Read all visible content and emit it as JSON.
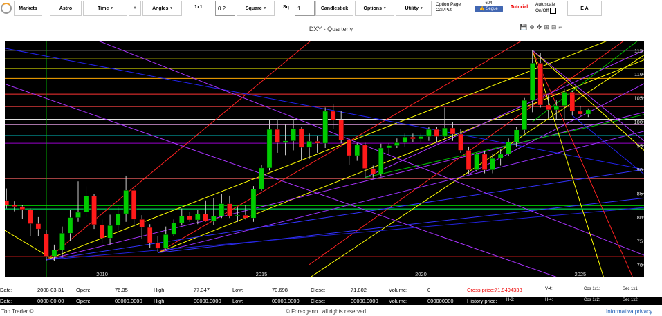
{
  "toolbar": {
    "markets": "Markets",
    "astro": "Astro",
    "time": "Time",
    "angles": "Angles",
    "ratio_label": "1x1",
    "ratio_value": "0.2",
    "square": "Square",
    "sq_label": "Sq",
    "sq_value": "1",
    "candlestick": "Candlestick",
    "options": "Options",
    "utility": "Utility",
    "option_page_line1": "Option Page",
    "option_page_line2": "Call/Put",
    "segue_count": "604",
    "segue_label": "Segue",
    "tutorial": "Tutorial",
    "autoscale_line1": "Autoscale",
    "autoscale_line2": "On/Off",
    "ea": "E A"
  },
  "title": "DXY - Quarterly",
  "chart_data": {
    "type": "candlestick",
    "title": "DXY - Quarterly",
    "x_ticks": [
      "2010",
      "2015",
      "2020",
      "2025"
    ],
    "y_ticks": [
      70,
      75,
      80,
      85,
      90,
      95,
      100,
      105,
      110,
      115
    ],
    "ylim": [
      67.5,
      117
    ],
    "candles": [
      {
        "x": 2007.0,
        "o": 83.5,
        "h": 86.0,
        "l": 81.8,
        "c": 82.5
      },
      {
        "x": 2007.25,
        "o": 82.5,
        "h": 83.3,
        "l": 81.2,
        "c": 82.2
      },
      {
        "x": 2007.5,
        "o": 82.2,
        "h": 82.5,
        "l": 79.6,
        "c": 81.6
      },
      {
        "x": 2007.75,
        "o": 81.6,
        "h": 81.8,
        "l": 76.0,
        "c": 78.6
      },
      {
        "x": 2008.0,
        "o": 78.6,
        "h": 80.0,
        "l": 76.0,
        "c": 77.5
      },
      {
        "x": 2008.25,
        "o": 76.4,
        "h": 77.3,
        "l": 70.7,
        "c": 71.8
      },
      {
        "x": 2008.5,
        "o": 71.8,
        "h": 74.2,
        "l": 70.7,
        "c": 73.1
      },
      {
        "x": 2008.75,
        "o": 73.1,
        "h": 78.0,
        "l": 71.5,
        "c": 76.6
      },
      {
        "x": 2009.0,
        "o": 76.6,
        "h": 81.5,
        "l": 75.0,
        "c": 79.9
      },
      {
        "x": 2009.25,
        "o": 79.9,
        "h": 87.5,
        "l": 79.0,
        "c": 81.0
      },
      {
        "x": 2009.5,
        "o": 81.0,
        "h": 86.5,
        "l": 80.0,
        "c": 84.4
      },
      {
        "x": 2009.75,
        "o": 84.4,
        "h": 84.8,
        "l": 77.5,
        "c": 78.4
      },
      {
        "x": 2010.0,
        "o": 78.4,
        "h": 79.5,
        "l": 74.5,
        "c": 75.6
      },
      {
        "x": 2010.25,
        "o": 75.6,
        "h": 80.5,
        "l": 74.2,
        "c": 78.2
      },
      {
        "x": 2010.5,
        "o": 78.2,
        "h": 82.0,
        "l": 77.2,
        "c": 80.7
      },
      {
        "x": 2010.75,
        "o": 80.7,
        "h": 88.7,
        "l": 79.0,
        "c": 85.6
      },
      {
        "x": 2011.0,
        "o": 85.6,
        "h": 86.0,
        "l": 78.0,
        "c": 79.5
      },
      {
        "x": 2011.25,
        "o": 79.5,
        "h": 80.4,
        "l": 75.5,
        "c": 77.8
      },
      {
        "x": 2011.5,
        "o": 77.8,
        "h": 78.5,
        "l": 73.5,
        "c": 74.6
      },
      {
        "x": 2011.75,
        "o": 74.6,
        "h": 76.0,
        "l": 72.7,
        "c": 73.4
      },
      {
        "x": 2012.0,
        "o": 73.4,
        "h": 78.0,
        "l": 73.0,
        "c": 76.3
      },
      {
        "x": 2012.25,
        "o": 76.3,
        "h": 79.5,
        "l": 76.0,
        "c": 78.8
      },
      {
        "x": 2012.5,
        "o": 78.8,
        "h": 81.8,
        "l": 78.2,
        "c": 80.2
      },
      {
        "x": 2012.75,
        "o": 80.2,
        "h": 81.0,
        "l": 79.0,
        "c": 79.4
      },
      {
        "x": 2013.0,
        "o": 79.4,
        "h": 81.5,
        "l": 78.5,
        "c": 80.6
      },
      {
        "x": 2013.25,
        "o": 80.6,
        "h": 83.5,
        "l": 79.0,
        "c": 79.1
      },
      {
        "x": 2013.5,
        "o": 79.1,
        "h": 84.0,
        "l": 78.3,
        "c": 80.2
      },
      {
        "x": 2013.75,
        "o": 80.2,
        "h": 84.8,
        "l": 79.8,
        "c": 82.8
      },
      {
        "x": 2014.0,
        "o": 82.8,
        "h": 84.5,
        "l": 79.8,
        "c": 80.2
      },
      {
        "x": 2014.25,
        "o": 80.2,
        "h": 82.0,
        "l": 79.0,
        "c": 80.4
      },
      {
        "x": 2014.5,
        "o": 80.4,
        "h": 82.5,
        "l": 79.5,
        "c": 79.8
      },
      {
        "x": 2014.75,
        "o": 79.8,
        "h": 86.5,
        "l": 79.0,
        "c": 85.9
      },
      {
        "x": 2015.0,
        "o": 85.9,
        "h": 91.0,
        "l": 85.5,
        "c": 90.3
      },
      {
        "x": 2015.25,
        "o": 90.3,
        "h": 100.3,
        "l": 89.8,
        "c": 98.4
      },
      {
        "x": 2015.5,
        "o": 98.4,
        "h": 100.5,
        "l": 93.5,
        "c": 95.6
      },
      {
        "x": 2015.75,
        "o": 95.6,
        "h": 99.5,
        "l": 93.0,
        "c": 96.0
      },
      {
        "x": 2016.0,
        "o": 96.0,
        "h": 100.5,
        "l": 94.0,
        "c": 98.6
      },
      {
        "x": 2016.25,
        "o": 98.6,
        "h": 98.8,
        "l": 92.0,
        "c": 94.6
      },
      {
        "x": 2016.5,
        "o": 94.6,
        "h": 97.5,
        "l": 92.2,
        "c": 95.9
      },
      {
        "x": 2016.75,
        "o": 95.9,
        "h": 97.0,
        "l": 93.5,
        "c": 95.5
      },
      {
        "x": 2017.0,
        "o": 95.5,
        "h": 103.0,
        "l": 94.5,
        "c": 102.2
      },
      {
        "x": 2017.25,
        "o": 102.2,
        "h": 103.8,
        "l": 98.5,
        "c": 100.4
      },
      {
        "x": 2017.5,
        "o": 100.4,
        "h": 102.3,
        "l": 95.5,
        "c": 96.2
      },
      {
        "x": 2017.75,
        "o": 96.2,
        "h": 96.5,
        "l": 91.0,
        "c": 92.9
      },
      {
        "x": 2018.0,
        "o": 92.9,
        "h": 95.5,
        "l": 91.8,
        "c": 95.1
      },
      {
        "x": 2018.25,
        "o": 95.1,
        "h": 95.6,
        "l": 88.3,
        "c": 90.2
      },
      {
        "x": 2018.5,
        "o": 90.2,
        "h": 90.8,
        "l": 88.3,
        "c": 89.1
      },
      {
        "x": 2018.75,
        "o": 89.1,
        "h": 95.4,
        "l": 88.5,
        "c": 94.5
      },
      {
        "x": 2019.0,
        "o": 94.5,
        "h": 95.5,
        "l": 93.2,
        "c": 95.0
      },
      {
        "x": 2019.25,
        "o": 95.0,
        "h": 96.5,
        "l": 94.5,
        "c": 95.6
      },
      {
        "x": 2019.5,
        "o": 95.6,
        "h": 97.5,
        "l": 94.8,
        "c": 96.8
      },
      {
        "x": 2019.75,
        "o": 96.8,
        "h": 97.5,
        "l": 95.8,
        "c": 96.4
      },
      {
        "x": 2020.0,
        "o": 96.4,
        "h": 97.5,
        "l": 95.8,
        "c": 96.9
      },
      {
        "x": 2020.25,
        "o": 96.9,
        "h": 99.0,
        "l": 96.0,
        "c": 98.4
      },
      {
        "x": 2020.5,
        "o": 98.4,
        "h": 99.0,
        "l": 95.8,
        "c": 96.9
      },
      {
        "x": 2020.75,
        "o": 96.9,
        "h": 103.0,
        "l": 96.4,
        "c": 98.7
      },
      {
        "x": 2021.0,
        "o": 98.7,
        "h": 100.0,
        "l": 96.0,
        "c": 97.4
      },
      {
        "x": 2021.25,
        "o": 97.4,
        "h": 98.5,
        "l": 93.5,
        "c": 94.0
      },
      {
        "x": 2021.5,
        "o": 94.0,
        "h": 94.8,
        "l": 89.0,
        "c": 89.9
      },
      {
        "x": 2021.75,
        "o": 89.9,
        "h": 93.5,
        "l": 89.5,
        "c": 93.2
      },
      {
        "x": 2022.0,
        "o": 93.2,
        "h": 93.8,
        "l": 89.2,
        "c": 89.9
      },
      {
        "x": 2022.25,
        "o": 89.9,
        "h": 93.2,
        "l": 89.2,
        "c": 92.3
      },
      {
        "x": 2022.5,
        "o": 92.3,
        "h": 94.2,
        "l": 90.8,
        "c": 93.2
      },
      {
        "x": 2022.75,
        "o": 93.2,
        "h": 96.5,
        "l": 92.8,
        "c": 95.7
      },
      {
        "x": 2023.0,
        "o": 95.7,
        "h": 99.0,
        "l": 94.8,
        "c": 98.3
      },
      {
        "x": 2023.25,
        "o": 98.3,
        "h": 105.0,
        "l": 97.5,
        "c": 104.5
      },
      {
        "x": 2023.5,
        "o": 104.5,
        "h": 115.0,
        "l": 102.0,
        "c": 112.3
      },
      {
        "x": 2023.75,
        "o": 112.3,
        "h": 114.5,
        "l": 103.0,
        "c": 103.5
      },
      {
        "x": 2024.0,
        "o": 103.5,
        "h": 105.5,
        "l": 100.8,
        "c": 102.5
      },
      {
        "x": 2024.25,
        "o": 102.5,
        "h": 104.5,
        "l": 100.5,
        "c": 103.4
      },
      {
        "x": 2024.5,
        "o": 103.4,
        "h": 107.0,
        "l": 100.3,
        "c": 106.2
      },
      {
        "x": 2024.75,
        "o": 106.2,
        "h": 106.6,
        "l": 101.3,
        "c": 102.2
      },
      {
        "x": 2025.0,
        "o": 102.2,
        "h": 103.3,
        "l": 101.2,
        "c": 101.6
      },
      {
        "x": 2025.25,
        "o": 101.6,
        "h": 102.8,
        "l": 101.0,
        "c": 102.5
      }
    ],
    "horizontal_levels": [
      {
        "y": 115.0,
        "color": "#c8c8c8"
      },
      {
        "y": 113.2,
        "color": "#cccc00"
      },
      {
        "y": 111.2,
        "color": "#ffff00"
      },
      {
        "y": 109.1,
        "color": "#ffaa00"
      },
      {
        "y": 105.8,
        "color": "#ff3333"
      },
      {
        "y": 103.2,
        "color": "#ff4444"
      },
      {
        "y": 100.5,
        "color": "#ffffff"
      },
      {
        "y": 99.4,
        "color": "#dd99dd"
      },
      {
        "y": 97.1,
        "color": "#00ffff"
      },
      {
        "y": 95.5,
        "color": "#9900cc"
      },
      {
        "y": 88.1,
        "color": "#ff6666"
      },
      {
        "y": 82.4,
        "color": "#00cc00"
      },
      {
        "y": 81.7,
        "color": "#00ff66"
      },
      {
        "y": 80.2,
        "color": "#ff9900"
      },
      {
        "y": 71.7,
        "color": "#ff2222"
      }
    ],
    "vertical_lines": [
      {
        "x": 2008.25,
        "color": "#00cc00"
      }
    ],
    "trend_lines": [
      {
        "x1": 2008.25,
        "y1": 71.0,
        "x2": 2027.0,
        "y2": 175.0,
        "color": "#ff2222"
      },
      {
        "x1": 2011.75,
        "y1": 72.5,
        "x2": 2027.0,
        "y2": 132.0,
        "color": "#ff2222"
      },
      {
        "x1": 2016.5,
        "y1": 70.0,
        "x2": 2027.0,
        "y2": 120.0,
        "color": "#ff2222"
      },
      {
        "x1": 2008.25,
        "y1": 71.0,
        "x2": 2027.0,
        "y2": 120.0,
        "color": "#ffff00"
      },
      {
        "x1": 2011.75,
        "y1": 72.5,
        "x2": 2027.0,
        "y2": 113.0,
        "color": "#ffff00"
      },
      {
        "x1": 2016.0,
        "y1": 65.0,
        "x2": 2027.0,
        "y2": 114.0,
        "color": "#ffff00"
      },
      {
        "x1": 2006.5,
        "y1": 79.0,
        "x2": 2008.5,
        "y2": 71.0,
        "color": "#ffff00"
      },
      {
        "x1": 2008.25,
        "y1": 71.0,
        "x2": 2027.0,
        "y2": 102.0,
        "color": "#aa33ff"
      },
      {
        "x1": 2011.75,
        "y1": 72.5,
        "x2": 2027.0,
        "y2": 98.0,
        "color": "#9933ff"
      },
      {
        "x1": 2018.25,
        "y1": 88.3,
        "x2": 2027.0,
        "y2": 115.0,
        "color": "#aa33ff"
      },
      {
        "x1": 2021.5,
        "y1": 89.0,
        "x2": 2027.0,
        "y2": 108.0,
        "color": "#aa33ff"
      },
      {
        "x1": 2008.25,
        "y1": 71.0,
        "x2": 2027.0,
        "y2": 90.0,
        "color": "#3333ff"
      },
      {
        "x1": 2011.75,
        "y1": 72.5,
        "x2": 2027.0,
        "y2": 84.0,
        "color": "#3333ff"
      },
      {
        "x1": 2008.25,
        "y1": 71.0,
        "x2": 2027.0,
        "y2": 82.0,
        "color": "#2222dd"
      },
      {
        "x1": 2018.25,
        "y1": 88.3,
        "x2": 2027.0,
        "y2": 101.5,
        "color": "#00bb00"
      },
      {
        "x1": 2023.5,
        "y1": 100.0,
        "x2": 2027.0,
        "y2": 118.0,
        "color": "#00bb00"
      },
      {
        "x1": 2006.5,
        "y1": 116.0,
        "x2": 2027.0,
        "y2": 90.0,
        "color": "#2222ee"
      },
      {
        "x1": 2006.5,
        "y1": 109.0,
        "x2": 2027.0,
        "y2": 61.0,
        "color": "#aa33ff"
      },
      {
        "x1": 2009.5,
        "y1": 118.0,
        "x2": 2027.0,
        "y2": 72.0,
        "color": "#aa33ff"
      },
      {
        "x1": 2023.5,
        "y1": 115.0,
        "x2": 2027.0,
        "y2": 94.0,
        "color": "#ffff00"
      },
      {
        "x1": 2023.5,
        "y1": 115.0,
        "x2": 2025.75,
        "y2": 67.0,
        "color": "#ffff00"
      },
      {
        "x1": 2023.5,
        "y1": 115.0,
        "x2": 2027.0,
        "y2": 62.0,
        "color": "#ff2222"
      },
      {
        "x1": 2023.5,
        "y1": 115.0,
        "x2": 2027.0,
        "y2": 96.0,
        "color": "#aa33ff"
      },
      {
        "x1": 2024.75,
        "y1": 101.3,
        "x2": 2027.0,
        "y2": 89.0,
        "color": "#2222ee"
      }
    ]
  },
  "info1": {
    "date_label": "Date:",
    "date_value": "2008-03-31",
    "open_label": "Open:",
    "open_value": "76.35",
    "high_label": "High:",
    "high_value": "77.347",
    "low_label": "Low:",
    "low_value": "70.698",
    "close_label": "Close:",
    "close_value": "71.802",
    "volume_label": "Volume:",
    "volume_value": "0",
    "cross_price": "Cross price:71.9494333",
    "v4": "V-4:",
    "cos1": "Cos 1x1:",
    "sec1": "Sec 1x1:"
  },
  "info2": {
    "date_label": "Date:",
    "date_value": "0000-00-00",
    "open_label": "Open:",
    "open_value": "00000.0000",
    "high_label": "High:",
    "high_value": "00000.0000",
    "low_label": "Low:",
    "low_value": "00000.0000",
    "close_label": "Close:",
    "close_value": "00000.0000",
    "volume_label": "Volume:",
    "volume_value": "000000000",
    "history_price": "History price:",
    "h3": "H-3:",
    "h4": "H-4:",
    "cos2": "Cos 1x2:",
    "sec2": "Sec 1x2:"
  },
  "footer": {
    "left": "Top Trader ©",
    "center": "© Forexgann | all rights reserved.",
    "right": "Informativa privacy"
  },
  "colors": {
    "bull": "#00cc00",
    "bear": "#ff1a1a",
    "background": "#000000",
    "link": "#1a5bb5"
  }
}
